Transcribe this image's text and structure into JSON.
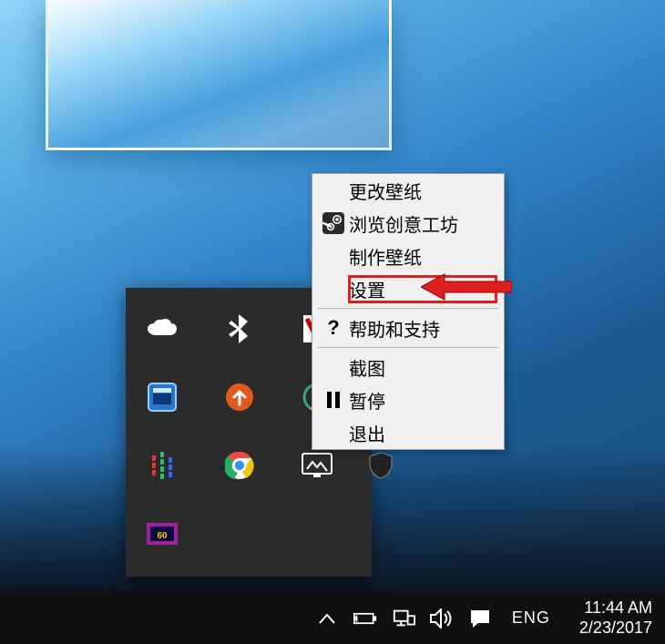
{
  "contextMenu": {
    "items": [
      {
        "id": "change-wallpaper",
        "label": "更改壁纸",
        "icon": null
      },
      {
        "id": "browse-workshop",
        "label": "浏览创意工坊",
        "icon": "steam"
      },
      {
        "id": "create-wallpaper",
        "label": "制作壁纸",
        "icon": null
      },
      {
        "id": "settings",
        "label": "设置",
        "icon": null,
        "highlighted": true
      },
      {
        "separator": true
      },
      {
        "id": "help-support",
        "label": "帮助和支持",
        "icon": "question"
      },
      {
        "separator": true
      },
      {
        "id": "screenshot",
        "label": "截图",
        "icon": null
      },
      {
        "id": "pause",
        "label": "暂停",
        "icon": "pause"
      },
      {
        "id": "exit",
        "label": "退出",
        "icon": null
      }
    ]
  },
  "trayFlyout": {
    "icons": [
      {
        "id": "onedrive",
        "name": "onedrive-icon"
      },
      {
        "id": "bluetooth",
        "name": "bluetooth-icon"
      },
      {
        "id": "app-v",
        "name": "app-v-icon"
      },
      {
        "id": "intel-gfx",
        "name": "intel-graphics-icon"
      },
      {
        "id": "updater",
        "name": "updater-icon"
      },
      {
        "id": "idm",
        "name": "download-manager-icon"
      },
      {
        "id": "audio-mix",
        "name": "audio-mixer-icon"
      },
      {
        "id": "chrome",
        "name": "chrome-icon"
      },
      {
        "id": "wallpaper",
        "name": "wallpaper-engine-icon",
        "selected": true
      },
      {
        "id": "defender",
        "name": "defender-icon"
      },
      {
        "id": "recorder",
        "name": "recorder-icon"
      }
    ]
  },
  "taskbar": {
    "lang": "ENG",
    "time": "11:44 AM",
    "date": "2/23/2017"
  }
}
